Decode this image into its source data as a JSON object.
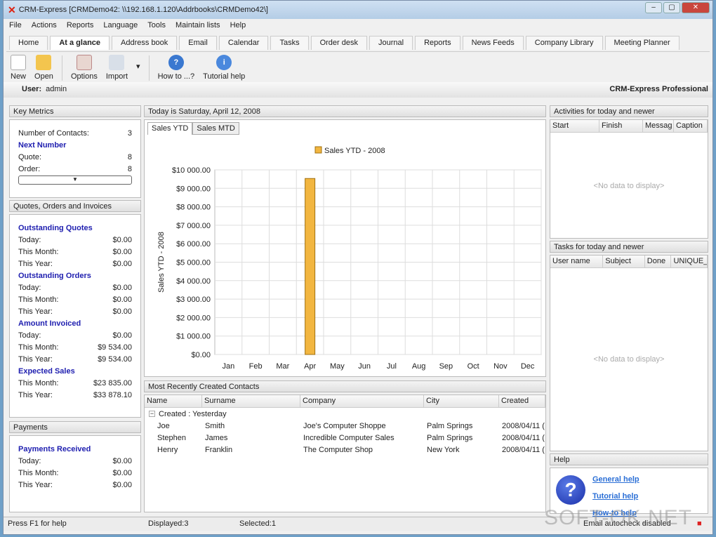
{
  "window": {
    "title": "CRM-Express [CRMDemo42: \\\\192.168.1.120\\Addrbooks\\CRMDemo42\\]"
  },
  "menu": [
    "File",
    "Actions",
    "Reports",
    "Language",
    "Tools",
    "Maintain lists",
    "Help"
  ],
  "tabs": [
    "Home",
    "At a glance",
    "Address book",
    "Email",
    "Calendar",
    "Tasks",
    "Order desk",
    "Journal",
    "Reports",
    "News Feeds",
    "Company Library",
    "Meeting Planner"
  ],
  "active_tab": "At a glance",
  "toolbar": {
    "new": "New",
    "open": "Open",
    "options": "Options",
    "import": "Import",
    "howto": "How to ...?",
    "tutorial": "Tutorial help"
  },
  "userbar": {
    "label": "User:",
    "user": "admin",
    "edition": "CRM-Express Professional"
  },
  "key_metrics": {
    "title": "Key Metrics",
    "contacts_label": "Number of Contacts:",
    "contacts": "3",
    "next_number": "Next Number",
    "quote_label": "Quote:",
    "quote": "8",
    "order_label": "Order:",
    "order": "8"
  },
  "qoi": {
    "title": "Quotes, Orders and Invoices",
    "sections": [
      {
        "name": "Outstanding Quotes",
        "rows": [
          [
            "Today:",
            "$0.00"
          ],
          [
            "This Month:",
            "$0.00"
          ],
          [
            "This Year:",
            "$0.00"
          ]
        ]
      },
      {
        "name": "Outstanding Orders",
        "rows": [
          [
            "Today:",
            "$0.00"
          ],
          [
            "This Month:",
            "$0.00"
          ],
          [
            "This Year:",
            "$0.00"
          ]
        ]
      },
      {
        "name": "Amount Invoiced",
        "rows": [
          [
            "Today:",
            "$0.00"
          ],
          [
            "This Month:",
            "$9 534.00"
          ],
          [
            "This Year:",
            "$9 534.00"
          ]
        ]
      },
      {
        "name": "Expected Sales",
        "rows": [
          [
            "This Month:",
            "$23 835.00"
          ],
          [
            "This Year:",
            "$33 878.10"
          ]
        ]
      }
    ]
  },
  "payments": {
    "title": "Payments",
    "section": "Payments Received",
    "rows": [
      [
        "Today:",
        "$0.00"
      ],
      [
        "This Month:",
        "$0.00"
      ],
      [
        "This Year:",
        "$0.00"
      ]
    ]
  },
  "today": {
    "title": "Today is Saturday, April 12, 2008",
    "tabs": [
      "Sales YTD",
      "Sales MTD"
    ]
  },
  "chart_data": {
    "type": "bar",
    "legend": "Sales YTD - 2008",
    "ylabel": "Sales YTD - 2008",
    "categories": [
      "Jan",
      "Feb",
      "Mar",
      "Apr",
      "May",
      "Jun",
      "Jul",
      "Aug",
      "Sep",
      "Oct",
      "Nov",
      "Dec"
    ],
    "values": [
      0,
      0,
      0,
      9534,
      0,
      0,
      0,
      0,
      0,
      0,
      0,
      0
    ],
    "ylim": [
      0,
      10000
    ],
    "yticks": [
      "$0.00",
      "$1 000.00",
      "$2 000.00",
      "$3 000.00",
      "$4 000.00",
      "$5 000.00",
      "$6 000.00",
      "$7 000.00",
      "$8 000.00",
      "$9 000.00",
      "$10 000.00"
    ],
    "grid": true,
    "bar_color": "#f2b640",
    "legend_position": "top"
  },
  "contacts": {
    "title": "Most Recently Created Contacts",
    "columns": [
      "Name",
      "Surname",
      "Company",
      "City",
      "Created"
    ],
    "group": "Created : Yesterday",
    "rows": [
      [
        "Joe",
        "Smith",
        "Joe's Computer Shoppe",
        "Palm Springs",
        "2008/04/11 ("
      ],
      [
        "Stephen",
        "James",
        "Incredible Computer Sales",
        "Palm Springs",
        "2008/04/11 ("
      ],
      [
        "Henry",
        "Franklin",
        "The Computer Shop",
        "New York",
        "2008/04/11 ("
      ]
    ]
  },
  "activities": {
    "title": "Activities for today and newer",
    "columns": [
      "Start",
      "Finish",
      "Messag",
      "Caption"
    ],
    "empty": "<No data to display>"
  },
  "tasks": {
    "title": "Tasks for today and newer",
    "columns": [
      "User name",
      "Subject",
      "Done",
      "UNIQUE_"
    ],
    "empty": "<No data to display>"
  },
  "help": {
    "title": "Help",
    "links": [
      "General help",
      "Tutorial help",
      "How-to help"
    ]
  },
  "status": {
    "hint": "Press F1 for help",
    "displayed": "Displayed:3",
    "selected": "Selected:1",
    "email": "Email autocheck disabled"
  },
  "watermark": "SOFT-OK.NET"
}
